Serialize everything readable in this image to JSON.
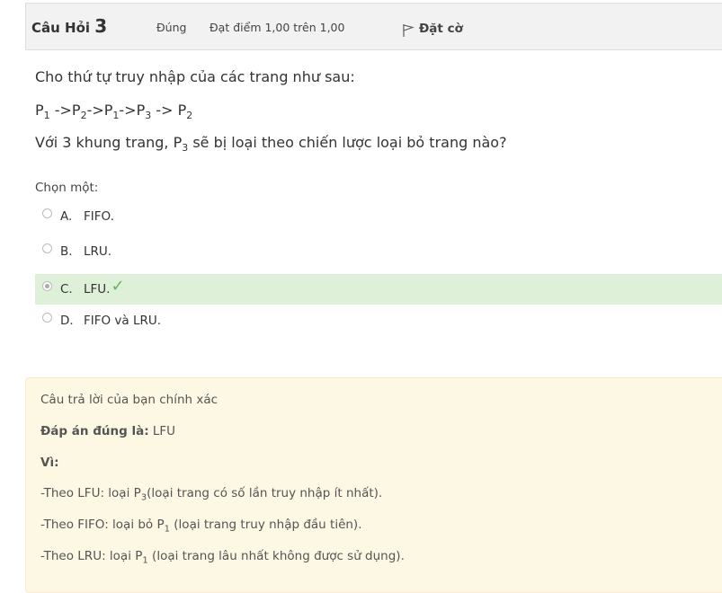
{
  "question": {
    "label": "Câu Hỏi",
    "number": "3",
    "state": "Đúng",
    "grade": "Đạt điểm 1,00 trên 1,00",
    "flag_label": "Đặt cờ"
  },
  "body": {
    "line1": "Cho thứ tự truy nhập của các trang như sau:",
    "seq": [
      {
        "t": "P",
        "s": "1"
      },
      {
        "t": " ->P",
        "s": "2"
      },
      {
        "t": "->P",
        "s": "1"
      },
      {
        "t": "->P",
        "s": "3"
      },
      {
        "t": " -> P",
        "s": "2"
      }
    ],
    "line3_before": "Với 3 khung trang, P",
    "line3_sub": "3",
    "line3_after": " sẽ bị loại theo chiến lược loại bỏ trang nào?"
  },
  "answer": {
    "prompt": "Chọn một:",
    "options": [
      {
        "letter": "A.",
        "text": "FIFO.",
        "selected": false,
        "correct": false
      },
      {
        "letter": "B.",
        "text": "LRU.",
        "selected": false,
        "correct": false
      },
      {
        "letter": "C.",
        "text": "LFU.",
        "selected": true,
        "correct": true
      },
      {
        "letter": "D.",
        "text": "FIFO và LRU.",
        "selected": false,
        "correct": false
      }
    ]
  },
  "feedback": {
    "general": "Câu trả lời của bạn chính xác",
    "right_label": "Đáp án đúng là:",
    "right_value": " LFU",
    "why": "Vì:",
    "lines": [
      {
        "before": "-Theo LFU: loại P",
        "sub": "3",
        "after": "(loại trang có số lần truy nhập ít nhất)."
      },
      {
        "before": "-Theo FIFO: loại bỏ P",
        "sub": "1",
        "after": " (loại trang truy nhập đầu tiên)."
      },
      {
        "before": "-Theo LRU: loại P",
        "sub": "1",
        "after": " (loại trang lâu nhất không được sử dụng)."
      }
    ]
  },
  "colors": {
    "correct_bg": "#dff0d8",
    "check": "#5cb85c",
    "feedback_bg": "#fcf8e3",
    "info_bg": "#f2f2f2"
  }
}
